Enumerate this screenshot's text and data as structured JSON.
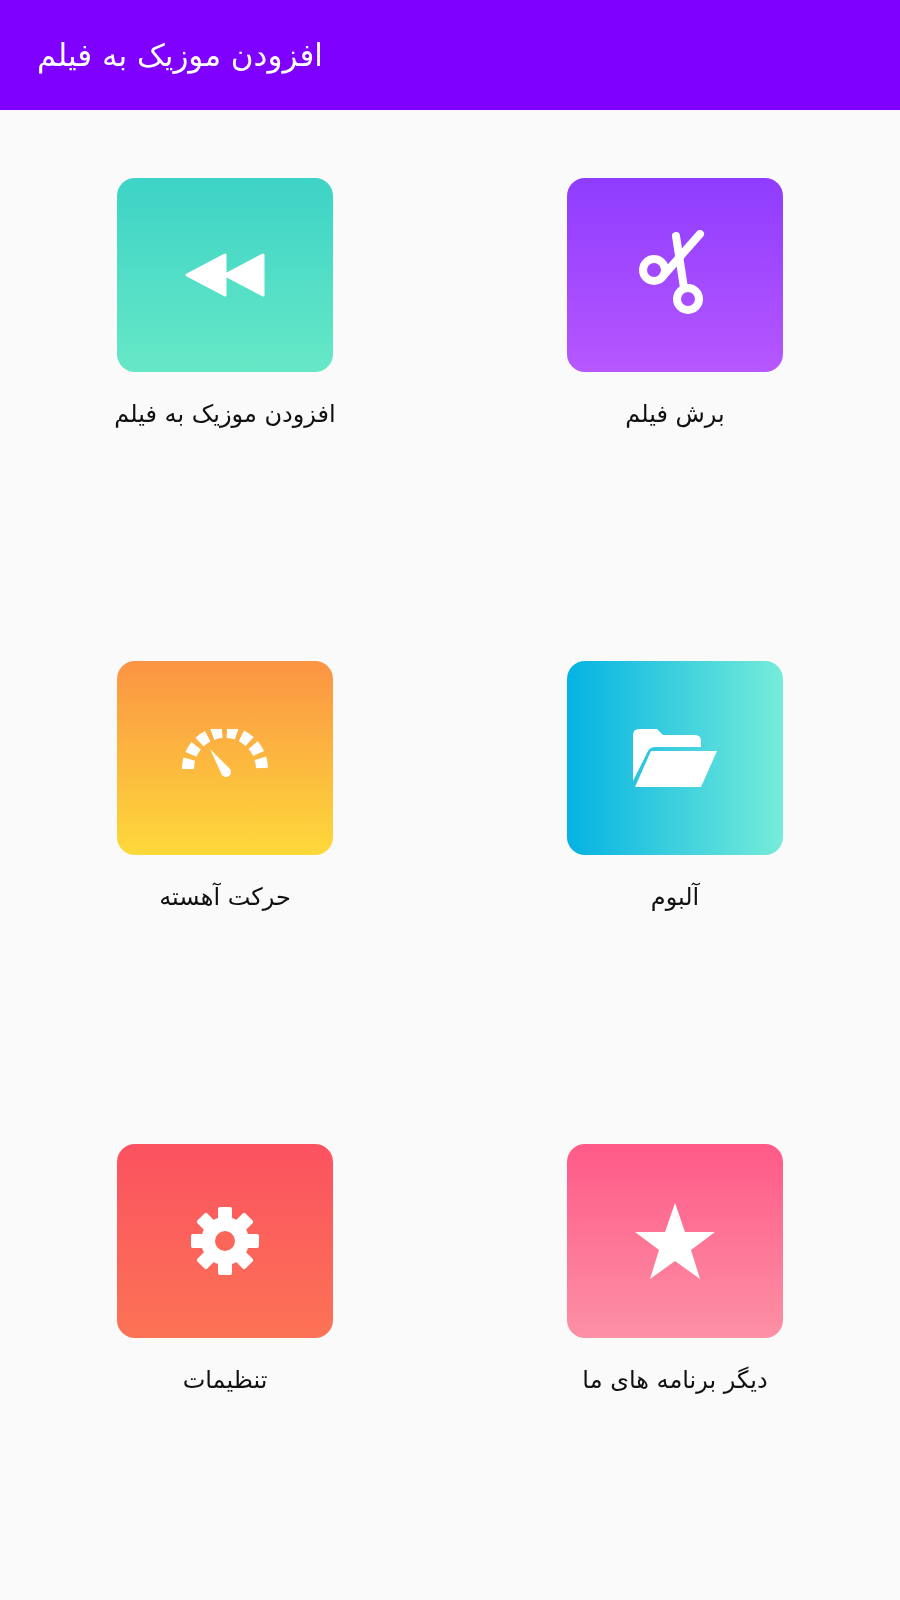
{
  "app_bar": {
    "title": "افزودن موزیک به فیلم"
  },
  "tiles": [
    {
      "kind": "scissors",
      "label": "برش فیلم"
    },
    {
      "kind": "rewind",
      "label": "افزودن موزیک به فیلم"
    },
    {
      "kind": "folder",
      "label": "آلبوم"
    },
    {
      "kind": "speedometer",
      "label": "حرکت آهسته"
    },
    {
      "kind": "star",
      "label": "دیگر برنامه های ما"
    },
    {
      "kind": "gear",
      "label": "تنظیمات"
    }
  ]
}
